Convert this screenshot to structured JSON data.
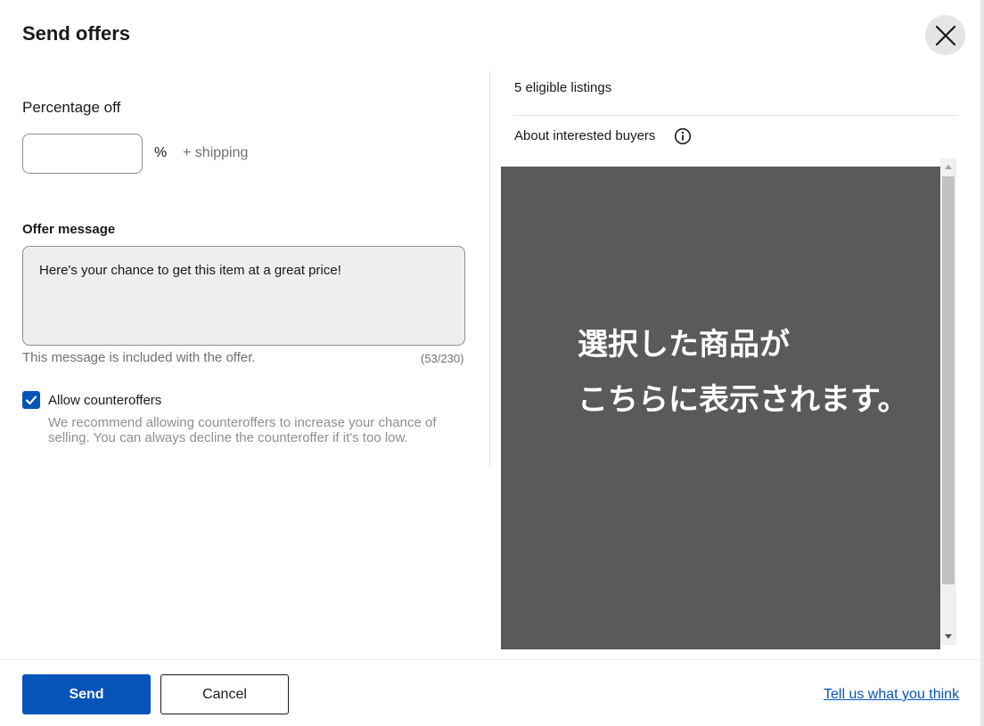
{
  "dialog": {
    "title": "Send offers",
    "close_icon": "close-icon"
  },
  "percentage": {
    "label": "Percentage off",
    "value": "",
    "unit": "%",
    "shipping_note": "+ shipping"
  },
  "message": {
    "label": "Offer message",
    "value": "Here's your chance to get this item at a great price!",
    "help": "This message is included with the offer.",
    "count": "(53/230)"
  },
  "counteroffers": {
    "checked": true,
    "label": "Allow counteroffers",
    "description": "We recommend allowing counteroffers to increase your chance of selling. You can always decline the counteroffer if it's too low."
  },
  "listings": {
    "eligible": "5 eligible listings",
    "about_buyers": "About interested buyers",
    "info_icon": "info-icon",
    "preview_line1": "選択した商品が",
    "preview_line2": "こちらに表示されます。"
  },
  "footer": {
    "send_label": "Send",
    "cancel_label": "Cancel",
    "feedback_link": "Tell us what you think"
  },
  "colors": {
    "primary": "#0654ba",
    "preview_bg": "#5a5a5a",
    "close_bg": "#e5e5e5"
  }
}
